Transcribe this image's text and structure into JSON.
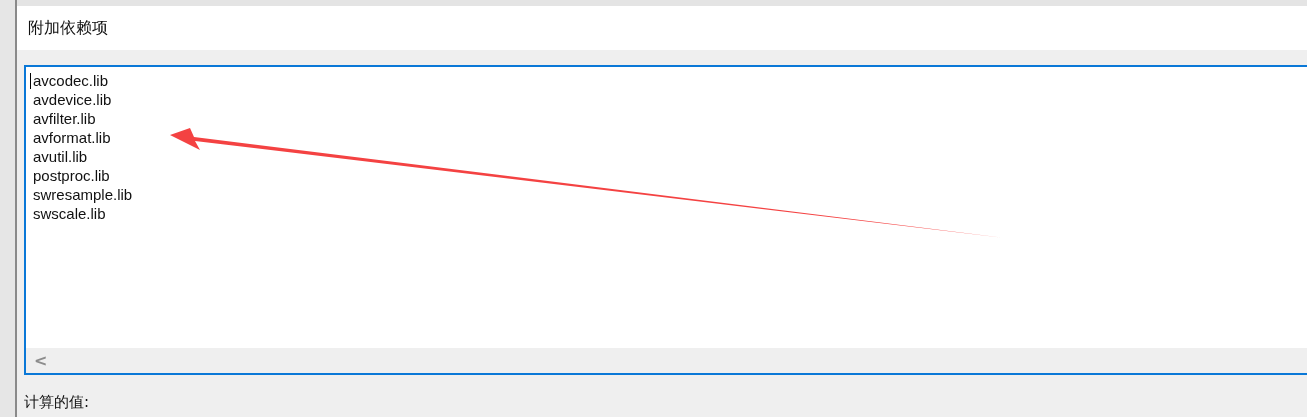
{
  "dialog": {
    "title": "附加依赖项",
    "lines": [
      "avcodec.lib",
      "avdevice.lib",
      "avfilter.lib",
      "avformat.lib",
      "avutil.lib",
      "postproc.lib",
      "swresample.lib",
      "swscale.lib"
    ],
    "scroll_left": "<",
    "computed_label": "计算的值:"
  }
}
